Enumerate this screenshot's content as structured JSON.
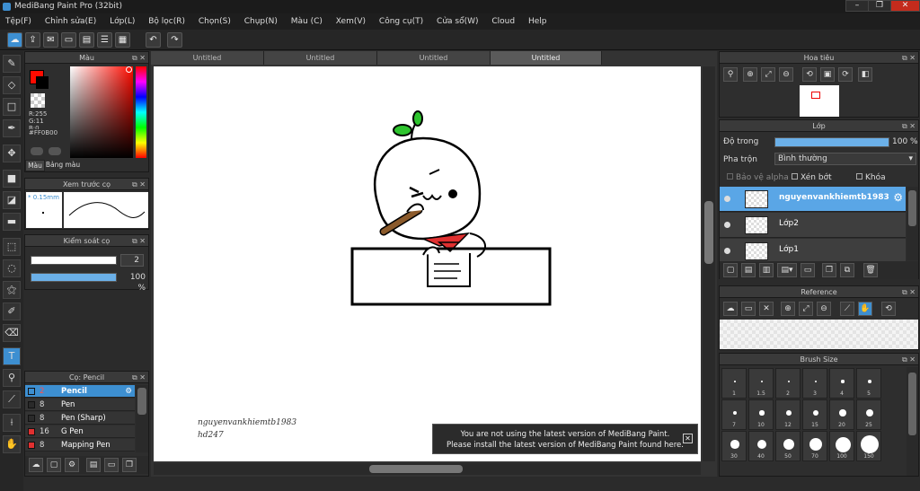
{
  "window": {
    "title": "MediBang Paint Pro (32bit)",
    "min": "–",
    "max": "❐",
    "close": "✕"
  },
  "menu": [
    "Tệp(F)",
    "Chỉnh sửa(E)",
    "Lớp(L)",
    "Bộ lọc(R)",
    "Chọn(S)",
    "Chụp(N)",
    "Màu (C)",
    "Xem(V)",
    "Công cụ(T)",
    "Cửa sổ(W)",
    "Cloud",
    "Help"
  ],
  "tabs": [
    "Untitled",
    "Untitled",
    "Untitled",
    "Untitled"
  ],
  "color_panel": {
    "title": "Màu",
    "r": "R:255",
    "g": "G:11",
    "b": "B:0",
    "hex": "#FF0B00",
    "tab_color": "Màu",
    "tab_palette": "Bảng màu",
    "primary_color": "#ff0b00"
  },
  "brush_preview": {
    "title": "Xem trước cọ",
    "size": "* 0.15mm"
  },
  "brush_control": {
    "title": "Kiểm soát cọ",
    "size_value": "2",
    "opacity_value": "100 %",
    "opacity_fraction": 1.0
  },
  "brush_list": {
    "title": "Cọ: Pencil",
    "items": [
      {
        "size": "2",
        "name": "Pencil",
        "color": "#3d8fd1",
        "active": true
      },
      {
        "size": "8",
        "name": "Pen",
        "color": "#2a2a2a",
        "active": false
      },
      {
        "size": "8",
        "name": "Pen (Sharp)",
        "color": "#2a2a2a",
        "active": false
      },
      {
        "size": "16",
        "name": "G Pen",
        "color": "#e03030",
        "active": false
      },
      {
        "size": "8",
        "name": "Mapping Pen",
        "color": "#e03030",
        "active": false
      }
    ]
  },
  "navigator": {
    "title": "Hoa tiêu"
  },
  "layers": {
    "title": "Lớp",
    "opacity_label": "Độ trong",
    "opacity_value": "100 %",
    "opacity_fraction": 1.0,
    "blend_label": "Pha trộn",
    "blend_value": "Bình thường",
    "protect_alpha": "Bảo vệ alpha",
    "clipping": "Xén bớt",
    "lock": "Khóa",
    "items": [
      {
        "name": "nguyenvankhiemtb1983",
        "active": true
      },
      {
        "name": "Lớp2",
        "active": false
      },
      {
        "name": "Lớp1",
        "active": false
      }
    ]
  },
  "reference": {
    "title": "Reference"
  },
  "brush_size": {
    "title": "Brush Size",
    "sizes": [
      "1",
      "1.5",
      "2",
      "3",
      "4",
      "5",
      "7",
      "10",
      "12",
      "15",
      "20",
      "25",
      "30",
      "40",
      "50",
      "70",
      "100",
      "150"
    ]
  },
  "canvas": {
    "signature_line1": "nguyenvankhiemtb1983",
    "signature_line2": "hd247"
  },
  "notice": {
    "line1": "You are not using the latest version of MediBang Paint.",
    "line2": "Please install the latest version of MediBang Paint found here.",
    "close": "✕"
  }
}
